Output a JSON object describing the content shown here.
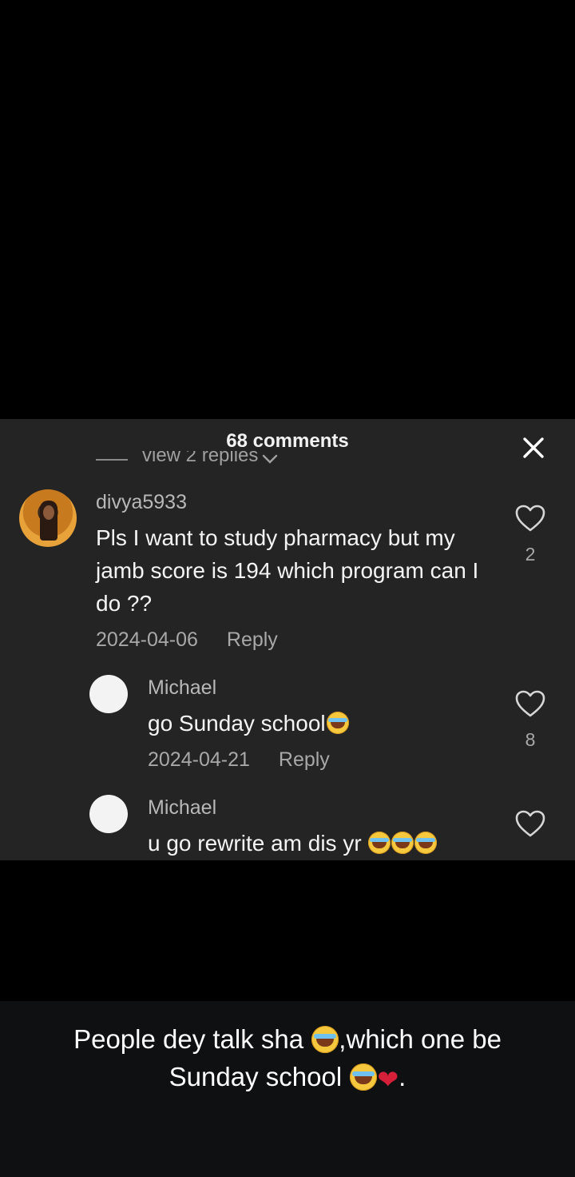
{
  "panel": {
    "title": "68 comments",
    "view_replies": "view 2 replies"
  },
  "comments": [
    {
      "username": "divya5933",
      "text": "Pls I want to study pharmacy but my jamb score is 194 which program can I do ??",
      "date": "2024-04-06",
      "reply_label": "Reply",
      "likes": "2"
    },
    {
      "username": "Michael",
      "text": "go Sunday school",
      "date": "2024-04-21",
      "reply_label": "Reply",
      "likes": "8"
    },
    {
      "username": "Michael",
      "text": "u go rewrite am dis yr "
    }
  ],
  "caption": {
    "part1": "People dey talk sha ",
    "part2": ",which one be Sunday school ",
    "part3": "."
  },
  "colors": {
    "panel_bg": "#242424",
    "page_bg": "#000000",
    "caption_bg": "#0f1012"
  },
  "icons": [
    "close-icon",
    "chevron-down-icon",
    "heart-outline-icon",
    "tears-of-joy-emoji",
    "broken-heart-emoji"
  ]
}
